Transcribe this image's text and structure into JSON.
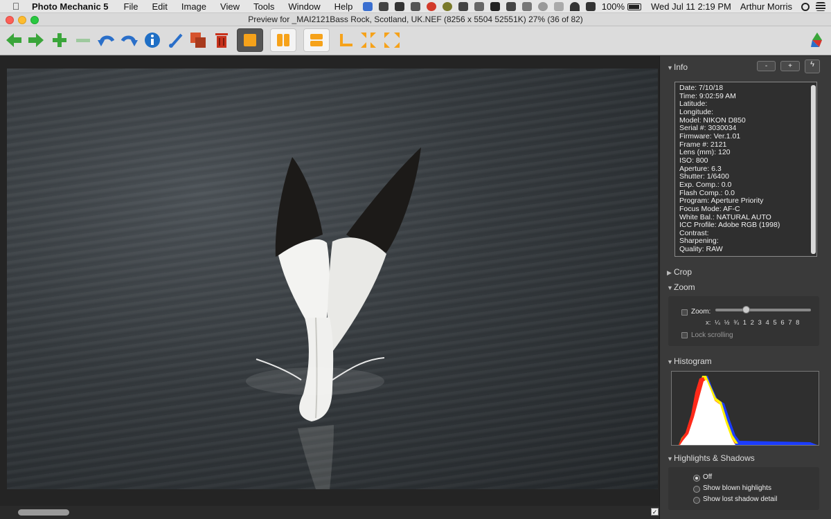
{
  "menubar": {
    "app_name": "Photo Mechanic 5",
    "menus": [
      "File",
      "Edit",
      "Image",
      "View",
      "Tools",
      "Window",
      "Help"
    ],
    "battery": "100%",
    "datetime": "Wed Jul 11  2:19 PM",
    "user": "Arthur Morris"
  },
  "window": {
    "title": "Preview for _MAI2121Bass Rock, Scotland, UK.NEF (8256 x 5504 52551K) 27% (36 of 82)"
  },
  "toolbar": {
    "icons": [
      "arrow-left-icon",
      "arrow-right-icon",
      "plus-icon",
      "minus-icon",
      "undo-icon",
      "redo-icon",
      "info-icon",
      "brush-icon",
      "copy-icon",
      "trash-icon",
      "single-view-icon",
      "split-vertical-icon",
      "split-horizontal-icon",
      "corner-icon",
      "fit-in-icon",
      "fit-out-icon",
      "logo-icon"
    ]
  },
  "panel": {
    "info": {
      "header": "Info",
      "minus_label": "-",
      "plus_label": "+",
      "lines": [
        "Date: 7/10/18",
        "Time: 9:02:59 AM",
        "Latitude:",
        "Longitude:",
        "Model: NIKON D850",
        "Serial #: 3030034",
        "Firmware: Ver.1.01",
        "Frame #: 2121",
        "Lens (mm): 120",
        "ISO: 800",
        "Aperture: 6.3",
        "Shutter: 1/6400",
        "Exp. Comp.: 0.0",
        "Flash Comp.: 0.0",
        "Program: Aperture Priority",
        "Focus Mode: AF-C",
        "White Bal.: NATURAL AUTO",
        "ICC Profile: Adobe RGB (1998)",
        "Contrast:",
        "Sharpening:",
        "Quality: RAW"
      ]
    },
    "crop": {
      "header": "Crop"
    },
    "zoom": {
      "header": "Zoom",
      "zoom_label": "Zoom:",
      "ticks": "x:  ¼  ½  ¾  1  2  3  4  5  6  7  8",
      "lock_label": "Lock scrolling"
    },
    "histogram": {
      "header": "Histogram"
    },
    "highlights": {
      "header": "Highlights & Shadows",
      "options": [
        "Off",
        "Show blown highlights",
        "Show lost shadow detail"
      ]
    }
  }
}
